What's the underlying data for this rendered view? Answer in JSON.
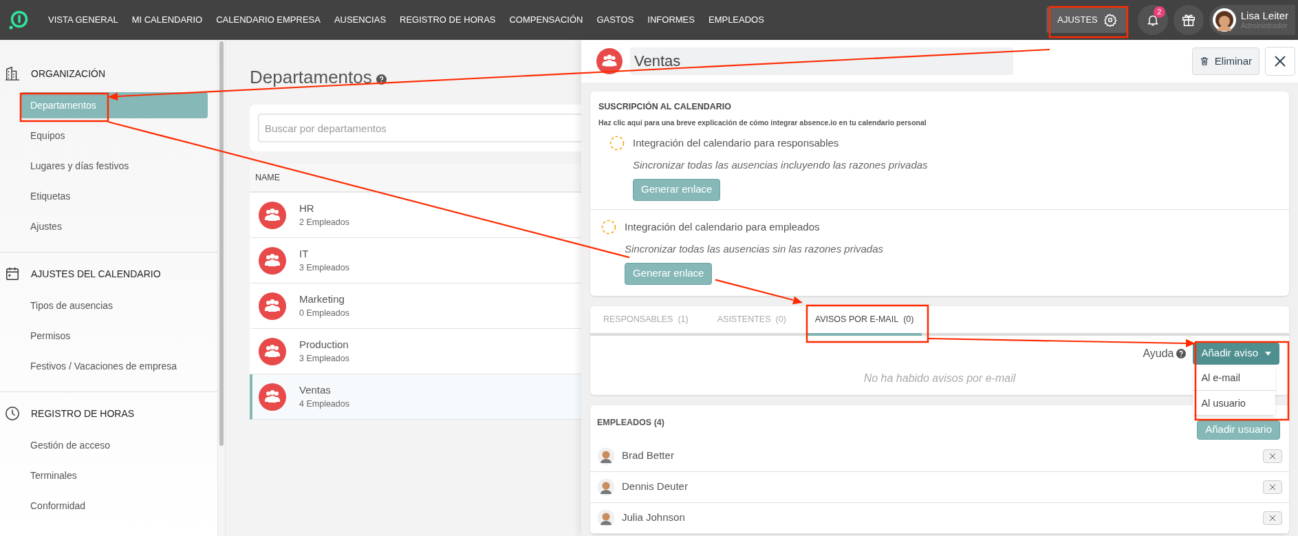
{
  "top_nav": {
    "items": [
      {
        "label": "VISTA GENERAL"
      },
      {
        "label": "MI CALENDARIO"
      },
      {
        "label": "CALENDARIO EMPRESA"
      },
      {
        "label": "AUSENCIAS"
      },
      {
        "label": "REGISTRO DE HORAS"
      },
      {
        "label": "COMPENSACIÓN"
      },
      {
        "label": "GASTOS"
      },
      {
        "label": "INFORMES"
      },
      {
        "label": "EMPLEADOS"
      }
    ],
    "settings_button": {
      "label": "AJUSTES",
      "selected": true
    },
    "notifications": {
      "count": "2"
    },
    "user": {
      "name": "Lisa Leiter",
      "role": "Administrador"
    }
  },
  "sidebar": {
    "sections": [
      {
        "title": "ORGANIZACIÓN",
        "items": [
          {
            "label": "Departamentos",
            "selected": true
          },
          {
            "label": "Equipos",
            "selected": false
          },
          {
            "label": "Lugares y días festivos",
            "selected": false
          },
          {
            "label": "Etiquetas",
            "selected": false
          },
          {
            "label": "Ajustes",
            "selected": false
          }
        ]
      },
      {
        "title": "AJUSTES DEL CALENDARIO",
        "items": [
          {
            "label": "Tipos de ausencias",
            "selected": false
          },
          {
            "label": "Permisos",
            "selected": false
          },
          {
            "label": "Festivos / Vacaciones de empresa",
            "selected": false
          }
        ]
      },
      {
        "title": "REGISTRO DE HORAS",
        "items": [
          {
            "label": "Gestión de acceso",
            "selected": false
          },
          {
            "label": "Terminales",
            "selected": false
          },
          {
            "label": "Conformidad",
            "selected": false
          }
        ]
      }
    ]
  },
  "main": {
    "title": "Departamentos",
    "search": {
      "placeholder": "Buscar por departamentos"
    },
    "table": {
      "columns": [
        "NAME"
      ],
      "rows": [
        {
          "name": "HR",
          "count": "2 Empleados",
          "selected": false
        },
        {
          "name": "IT",
          "count": "3 Empleados",
          "selected": false
        },
        {
          "name": "Marketing",
          "count": "0 Empleados",
          "selected": false
        },
        {
          "name": "Production",
          "count": "3 Empleados",
          "selected": false
        },
        {
          "name": "Ventas",
          "count": "4 Empleados",
          "selected": true
        }
      ]
    }
  },
  "detail": {
    "name": "Ventas",
    "delete_button": "Eliminar",
    "subscription": {
      "title": "SUSCRIPCIÓN AL CALENDARIO",
      "intro": "Haz clic **aquí** para una breve explicación de cómo integrar absence.io en tu calendario personal",
      "integrations": [
        {
          "title": "Integración del calendario para responsables",
          "description": "Sincronizar todas las ausencias incluyendo las razones privadas",
          "button": "Generar enlace"
        },
        {
          "title": "Integración del calendario para empleados",
          "description": "Sincronizar todas las ausencias sin las razones privadas",
          "button": "Generar enlace"
        }
      ]
    },
    "tabs": [
      {
        "label": "RESPONSABLES",
        "count": "(1)",
        "selected": false
      },
      {
        "label": "ASISTENTES",
        "count": "(0)",
        "selected": false
      },
      {
        "label": "AVISOS POR E-MAIL",
        "count": "(0)",
        "selected": true
      }
    ],
    "help": "Ayuda",
    "add_notice_button": "Añadir aviso",
    "dropdown": [
      "Al e-mail",
      "Al usuario"
    ],
    "empty_message": "No ha habido avisos por e-mail",
    "employees": {
      "title": "EMPLEADOS (4)",
      "add_button": "Añadir usuario",
      "rows": [
        {
          "name": "Brad Better"
        },
        {
          "name": "Dennis Deuter"
        },
        {
          "name": "Julia Johnson"
        }
      ]
    }
  }
}
